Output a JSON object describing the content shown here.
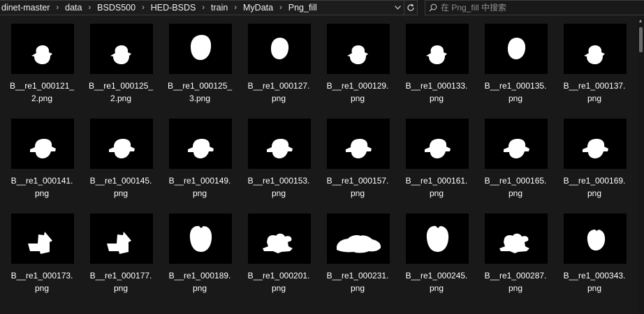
{
  "breadcrumb": {
    "segments": [
      "dinet-master",
      "data",
      "BSDS500",
      "HED-BSDS",
      "train",
      "MyData",
      "Png_fill"
    ],
    "separator": "›"
  },
  "address_controls": {
    "dropdown_icon": "chevron-down-icon",
    "refresh_icon": "refresh-icon"
  },
  "search": {
    "placeholder": "在 Png_fill 中搜索",
    "icon": "search-icon"
  },
  "files": [
    {
      "line1": "B__re1_000121_",
      "line2": "2.png",
      "shape": "round-hat"
    },
    {
      "line1": "B__re1_000125_",
      "line2": "2.png",
      "shape": "round-hat"
    },
    {
      "line1": "B__re1_000125_",
      "line2": "3.png",
      "shape": "big-round"
    },
    {
      "line1": "B__re1_000127.",
      "line2": "png",
      "shape": "big-round-small"
    },
    {
      "line1": "B__re1_000129.",
      "line2": "png",
      "shape": "round-hat"
    },
    {
      "line1": "B__re1_000133.",
      "line2": "png",
      "shape": "round-hat"
    },
    {
      "line1": "B__re1_000135.",
      "line2": "png",
      "shape": "big-round-small"
    },
    {
      "line1": "B__re1_000137.",
      "line2": "png",
      "shape": "round-hat"
    },
    {
      "line1": "B__re1_000141.",
      "line2": "png",
      "shape": "cap"
    },
    {
      "line1": "B__re1_000145.",
      "line2": "png",
      "shape": "cap"
    },
    {
      "line1": "B__re1_000149.",
      "line2": "png",
      "shape": "cap"
    },
    {
      "line1": "B__re1_000153.",
      "line2": "png",
      "shape": "cap"
    },
    {
      "line1": "B__re1_000157.",
      "line2": "png",
      "shape": "cap"
    },
    {
      "line1": "B__re1_000161.",
      "line2": "png",
      "shape": "cap"
    },
    {
      "line1": "B__re1_000165.",
      "line2": "png",
      "shape": "cap"
    },
    {
      "line1": "B__re1_000169.",
      "line2": "png",
      "shape": "cap"
    },
    {
      "line1": "B__re1_000173.",
      "line2": "png",
      "shape": "house"
    },
    {
      "line1": "B__re1_000177.",
      "line2": "png",
      "shape": "house"
    },
    {
      "line1": "B__re1_000189.",
      "line2": "png",
      "shape": "apple"
    },
    {
      "line1": "B__re1_000201.",
      "line2": "png",
      "shape": "blob"
    },
    {
      "line1": "B__re1_000231.",
      "line2": "png",
      "shape": "flat"
    },
    {
      "line1": "B__re1_000245.",
      "line2": "png",
      "shape": "apple"
    },
    {
      "line1": "B__re1_000287.",
      "line2": "png",
      "shape": "blob"
    },
    {
      "line1": "B__re1_000343.",
      "line2": "png",
      "shape": "apple-small"
    }
  ]
}
